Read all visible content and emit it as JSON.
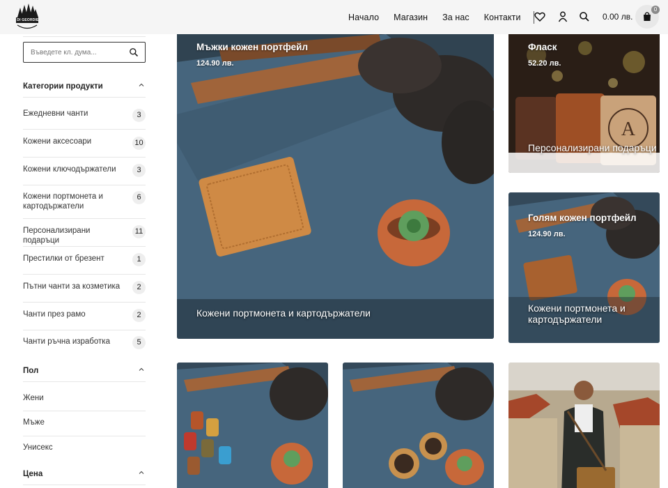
{
  "header": {
    "brand": "DI GEORDIE",
    "nav": [
      "Начало",
      "Магазин",
      "За нас",
      "Контакти"
    ],
    "cart_total": "0.00 лв.",
    "cart_count": "0"
  },
  "sidebar": {
    "search_placeholder": "Въведете кл. дума...",
    "categories_title": "Категории продукти",
    "categories": [
      {
        "label": "Ежедневни чанти",
        "count": "3"
      },
      {
        "label": "Кожени аксесоари",
        "count": "10"
      },
      {
        "label": "Кожени ключодържатели",
        "count": "3"
      },
      {
        "label": "Кожени портмонета и картодържатели",
        "count": "6"
      },
      {
        "label": "Персонализирани подаръци",
        "count": "11"
      },
      {
        "label": "Престилки от брезент",
        "count": "1"
      },
      {
        "label": "Пътни чанти за козметика",
        "count": "2"
      },
      {
        "label": "Чанти през рамо",
        "count": "2"
      },
      {
        "label": "Чанти ръчна изработка",
        "count": "5"
      }
    ],
    "gender_title": "Пол",
    "genders": [
      "Жени",
      "Мъже",
      "Унисекс"
    ],
    "price_title": "Цена"
  },
  "products": [
    {
      "name": "Мъжки кожен портфейл",
      "price": "124.90 лв.",
      "category": "Кожени портмонета и картодържатели"
    },
    {
      "name": "Фласк",
      "price": "52.20 лв.",
      "category": "Персонализирани подаръци"
    },
    {
      "name": "Голям кожен портфейл",
      "price": "124.90 лв.",
      "category": "Кожени портмонета и картодържатели"
    }
  ],
  "colors": {
    "header_bg": "#f5f5f5",
    "text": "#222222",
    "divider": "#e6e6e6",
    "badge": "#eeeeee"
  }
}
